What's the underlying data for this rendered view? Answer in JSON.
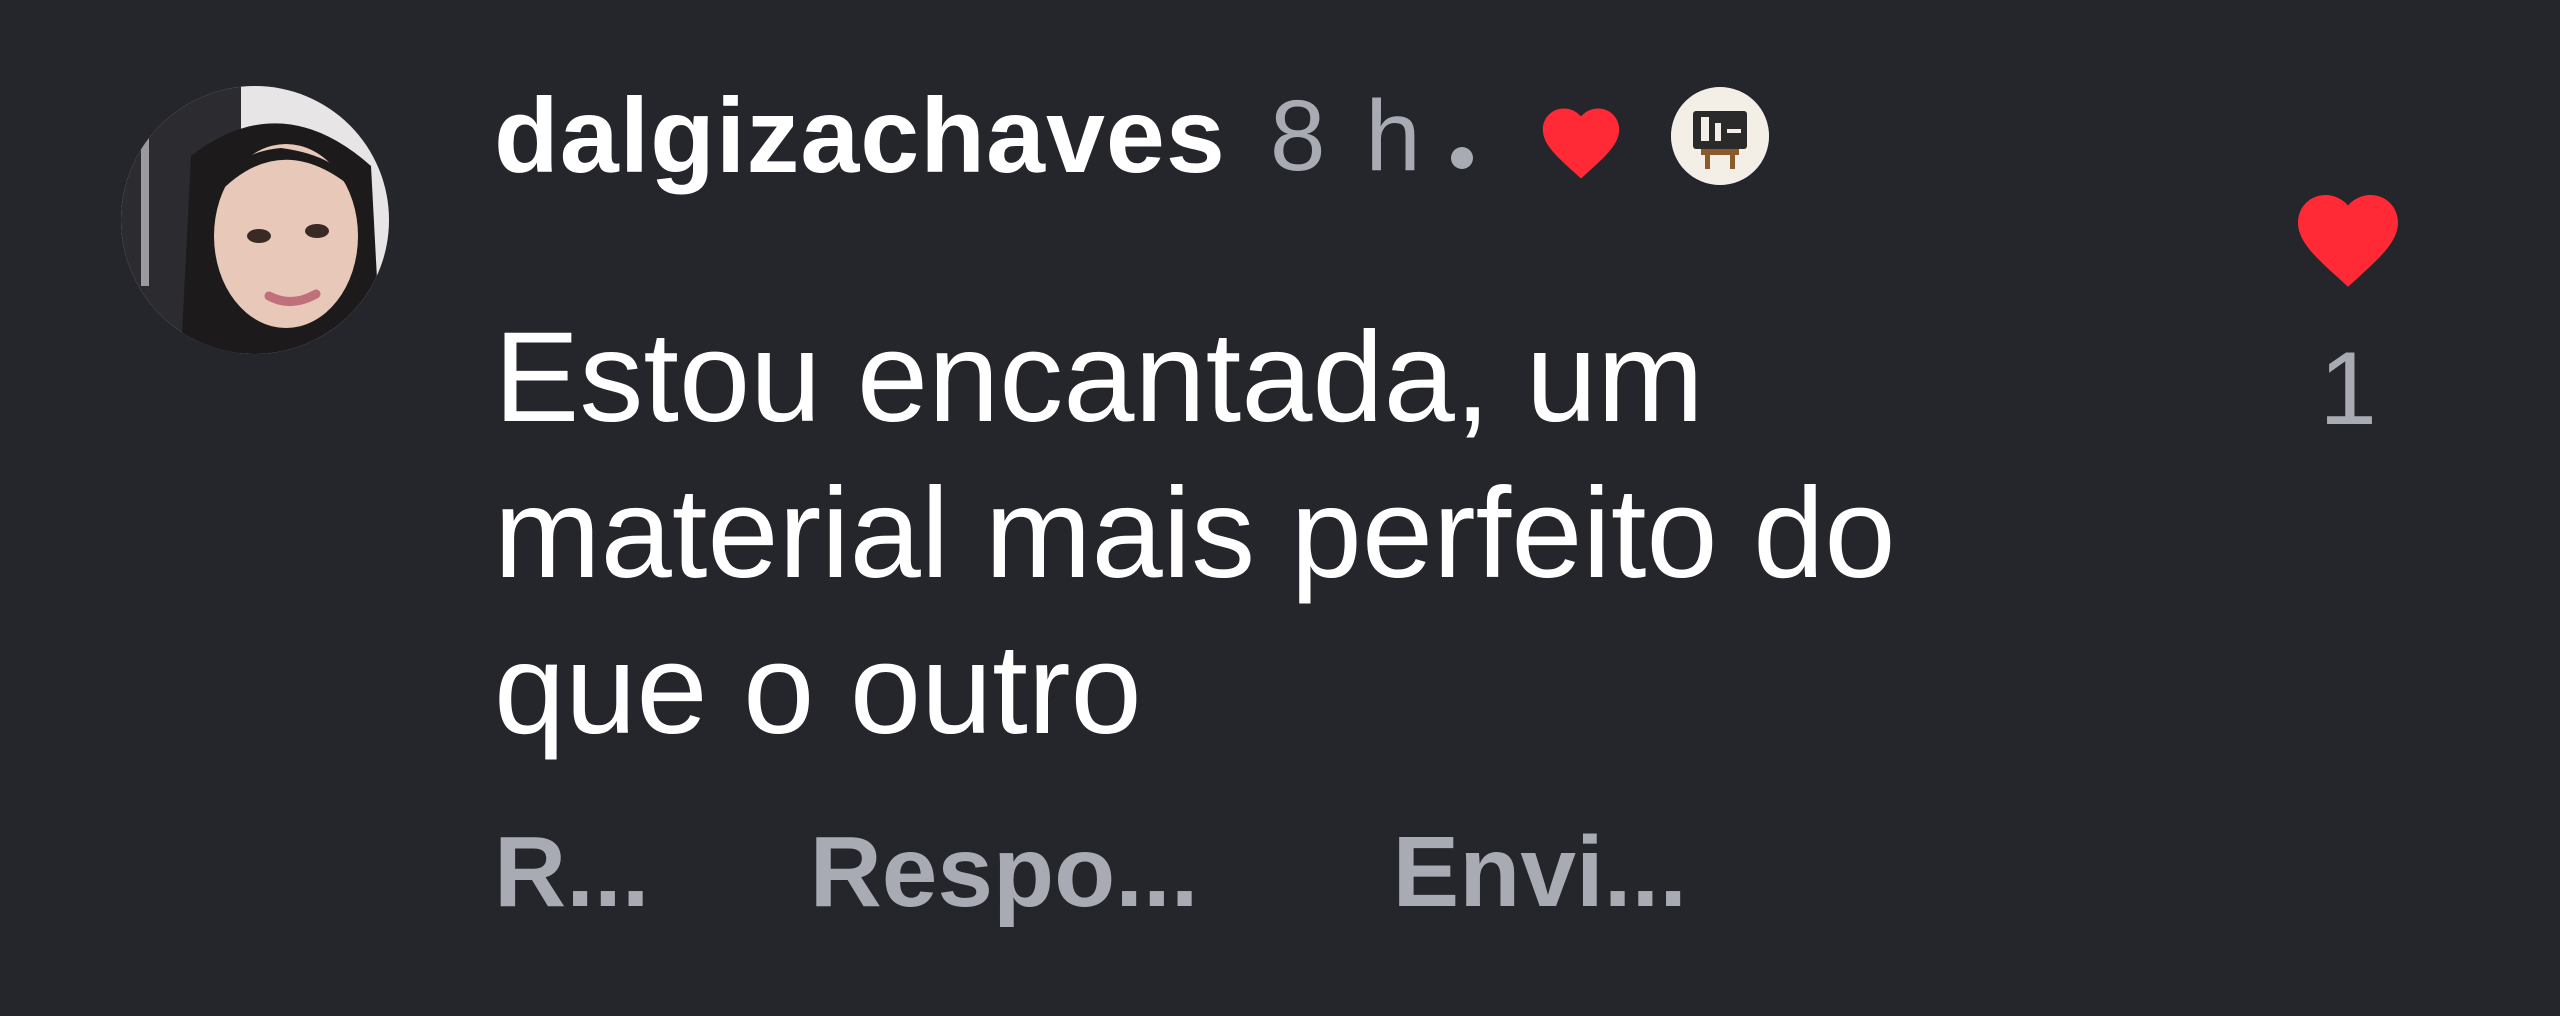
{
  "comment": {
    "username": "dalgizachaves",
    "time": "8 h",
    "text_lines": [
      "Estou encantada, um",
      "material mais perfeito do",
      "que o outro"
    ],
    "actions": {
      "reply": "R...",
      "replies": "Respo...",
      "send": "Envi..."
    },
    "like_count": "1",
    "liked_by_author": true
  },
  "colors": {
    "background": "#25262b",
    "text": "#ffffff",
    "muted": "#a8abb3",
    "heart": "#ff2a35"
  },
  "icons": {
    "author_like": "heart-icon",
    "creator_badge": "creator-avatar-icon",
    "like": "heart-icon"
  }
}
